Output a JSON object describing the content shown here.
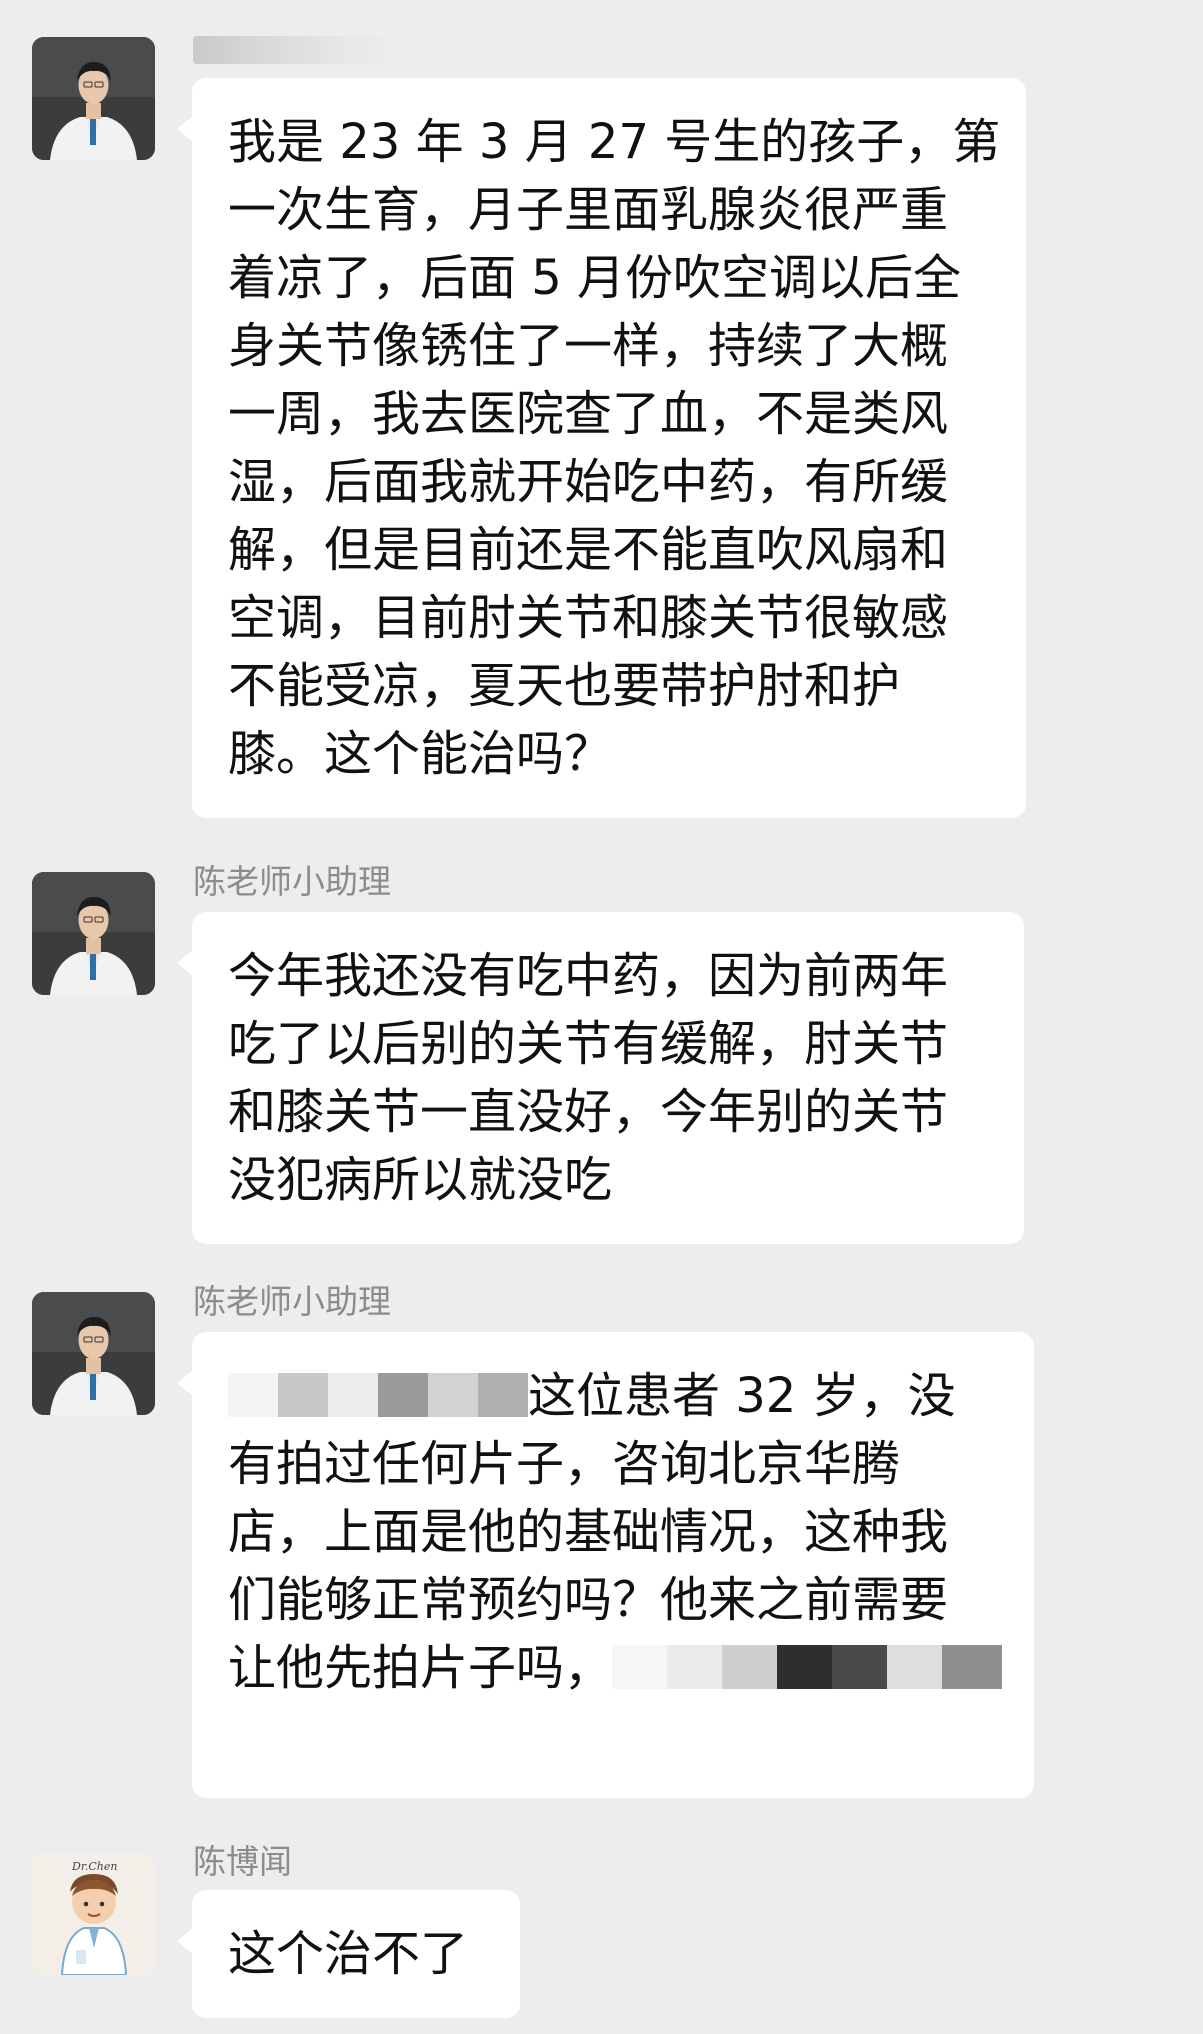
{
  "messages": [
    {
      "sender": "",
      "avatar": "doctor-photo-avatar",
      "lines": [
        "我是 23 年 3 月 27 号生的孩子，第",
        "一次生育，月子里面乳腺炎很严重",
        "着凉了，后面 5 月份吹空调以后全",
        "身关节像锈住了一样，持续了大概",
        "一周，我去医院查了血，不是类风",
        "湿，后面我就开始吃中药，有所缓",
        "解，但是目前还是不能直吹风扇和",
        "空调，目前肘关节和膝关节很敏感",
        "不能受凉，夏天也要带护肘和护",
        "膝。这个能治吗？"
      ]
    },
    {
      "sender": "陈老师小助理",
      "avatar": "doctor-photo-avatar",
      "lines": [
        "今年我还没有吃中药，因为前两年",
        "吃了以后别的关节有缓解，肘关节",
        "和膝关节一直没好，今年别的关节",
        "没犯病所以就没吃"
      ]
    },
    {
      "sender": "陈老师小助理",
      "avatar": "doctor-photo-avatar",
      "line1_text": "这位患者 32 岁，没",
      "lines": [
        "有拍过任何片子，咨询北京华腾",
        "店，上面是他的基础情况，这种我",
        "们能够正常预约吗？他来之前需要"
      ],
      "last_line_text": "让他先拍片子吗，"
    },
    {
      "sender": "陈博闻",
      "avatar": "cartoon-doctor-avatar",
      "avatar_caption": "Dr.Chen",
      "lines": [
        "这个治不了"
      ]
    }
  ]
}
